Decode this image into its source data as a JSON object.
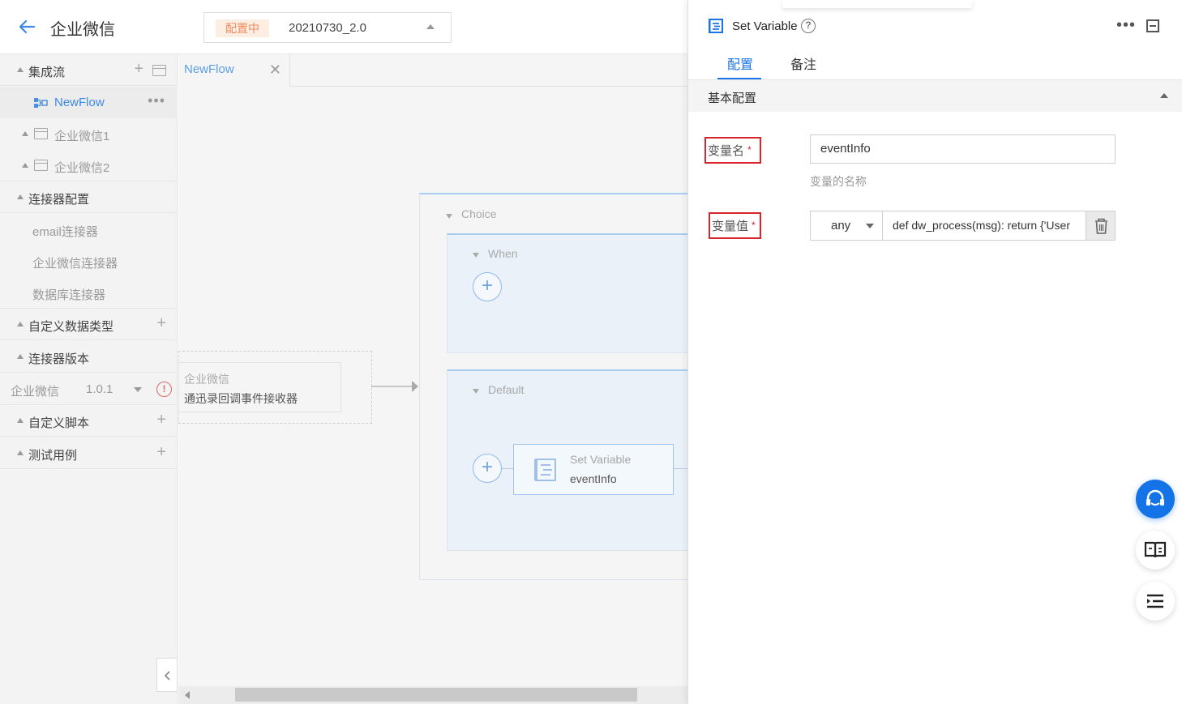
{
  "header": {
    "app_title": "企业微信",
    "status_badge": "配置中",
    "version": "20210730_2.0"
  },
  "sidebar": {
    "flows_label": "集成流",
    "flow_item": "NewFlow",
    "group1": "企业微信1",
    "group2": "企业微信2",
    "connector_config_label": "连接器配置",
    "connectors": [
      "email连接器",
      "企业微信连接器",
      "数据库连接器"
    ],
    "custom_types_label": "自定义数据类型",
    "connector_version_label": "连接器版本",
    "version_row": {
      "name": "企业微信",
      "version": "1.0.1"
    },
    "custom_scripts_label": "自定义脚本",
    "test_cases_label": "测试用例"
  },
  "canvas": {
    "tab_label": "NewFlow",
    "source_node": {
      "title": "企业微信",
      "subtitle": "通迅录回调事件接收器"
    },
    "choice_label": "Choice",
    "when_label": "When",
    "default_label": "Default",
    "set_variable_node": {
      "title": "Set Variable",
      "subtitle": "eventInfo"
    }
  },
  "panel": {
    "title": "Set Variable",
    "tabs": [
      "配置",
      "备注"
    ],
    "active_tab": 0,
    "section_title": "基本配置",
    "var_name_label": "变量名",
    "var_name_value": "eventInfo",
    "var_name_help": "变量的名称",
    "var_value_label": "变量值",
    "var_type": "any",
    "var_value_text": "def dw_process(msg):    return {'User"
  },
  "colors": {
    "primary": "#1a73e8",
    "highlight_box": "#d9232d",
    "status_orange": "#f08a5d"
  },
  "icons": [
    "back-arrow-icon",
    "add-icon",
    "folder-icon",
    "flow-icon",
    "more-icon",
    "warning-icon",
    "close-icon",
    "help-icon",
    "set-variable-icon",
    "minimize-icon",
    "delete-icon",
    "headset-icon",
    "book-icon",
    "outline-icon"
  ]
}
